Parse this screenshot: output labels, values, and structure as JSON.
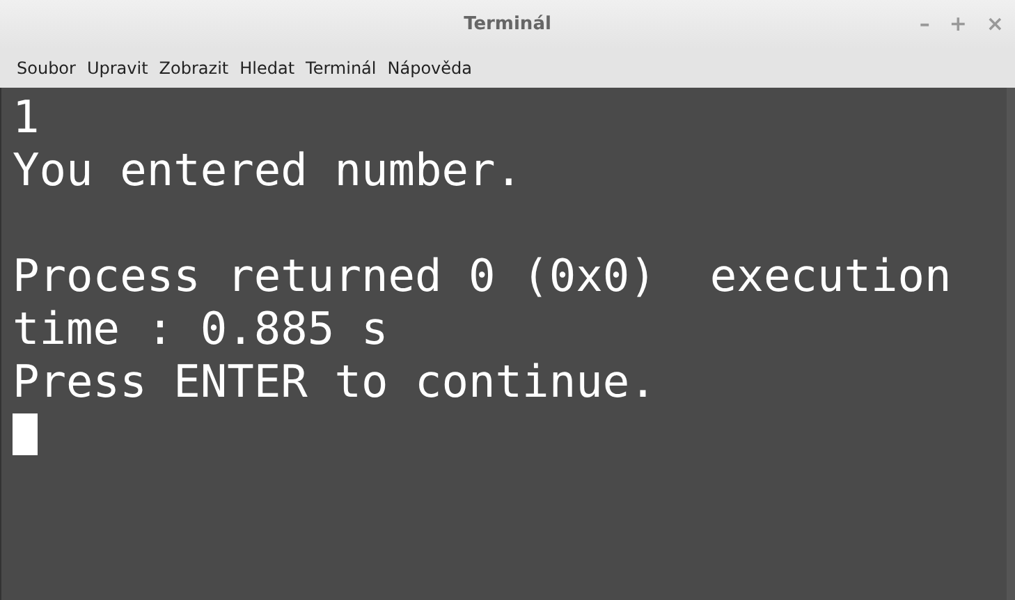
{
  "window": {
    "title": "Terminál",
    "controls": [
      "–",
      "+",
      "×"
    ]
  },
  "menu": [
    "Soubor",
    "Upravit",
    "Zobrazit",
    "Hledat",
    "Terminál",
    "Nápověda"
  ],
  "terminal": {
    "blocks": [
      [
        "1",
        "You entered number."
      ],
      [
        "Process returned 0 (0x0)  execution",
        "time : 0.885 s",
        "Press ENTER to continue."
      ]
    ],
    "cursor": true
  }
}
